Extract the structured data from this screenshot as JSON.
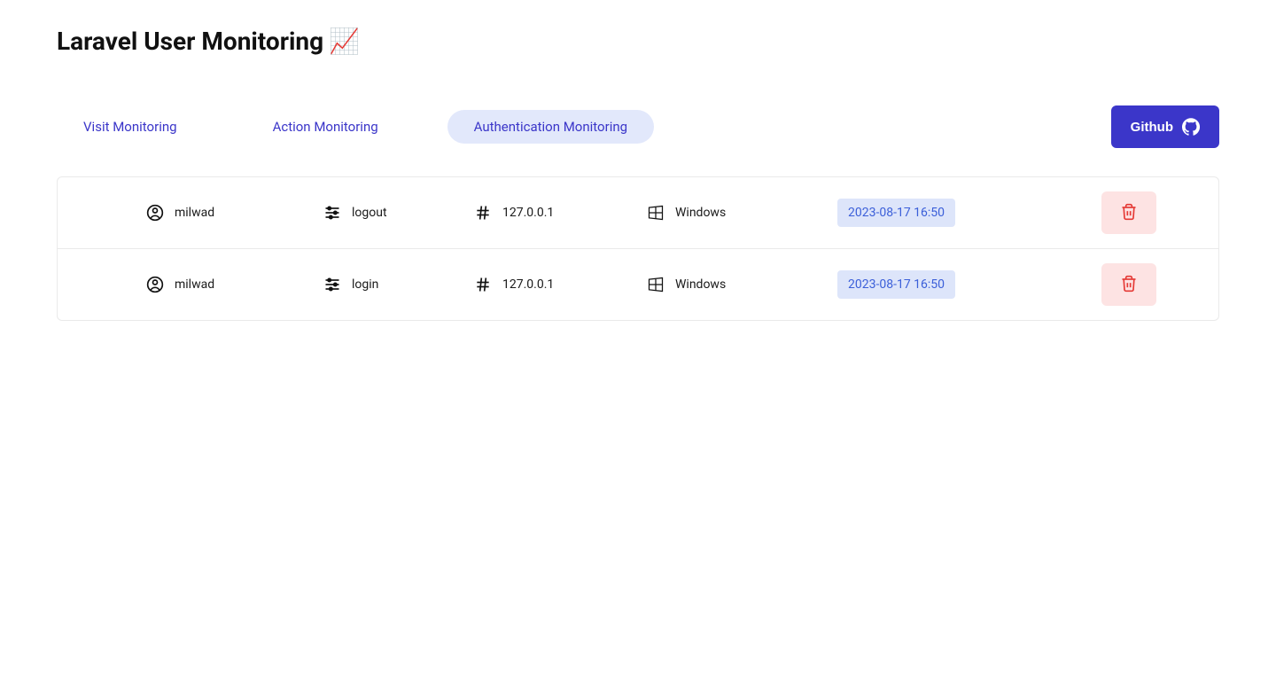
{
  "page_title": "Laravel User Monitoring",
  "title_emoji": "📈",
  "tabs": {
    "visit": "Visit Monitoring",
    "action": "Action Monitoring",
    "auth": "Authentication Monitoring"
  },
  "github_label": "Github",
  "rows": [
    {
      "user": "milwad",
      "action": "logout",
      "ip": "127.0.0.1",
      "os": "Windows",
      "date": "2023-08-17 16:50"
    },
    {
      "user": "milwad",
      "action": "login",
      "ip": "127.0.0.1",
      "os": "Windows",
      "date": "2023-08-17 16:50"
    }
  ]
}
